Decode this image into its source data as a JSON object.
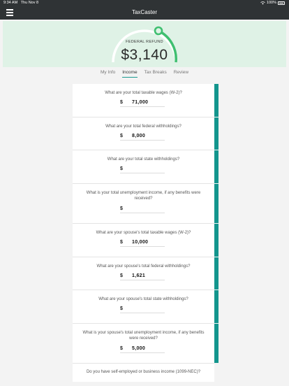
{
  "status_bar": {
    "time": "9:34 AM",
    "date": "Thu Nov 8",
    "battery": "100%"
  },
  "app": {
    "title": "TaxCaster"
  },
  "refund": {
    "label": "FEDERAL REFUND",
    "amount": "$3,140"
  },
  "tabs": [
    {
      "label": "My Info",
      "active": false
    },
    {
      "label": "Income",
      "active": true
    },
    {
      "label": "Tax Breaks",
      "active": false
    },
    {
      "label": "Review",
      "active": false
    }
  ],
  "colors": {
    "accent": "#13958d",
    "panel": "#dff2e6",
    "header": "#2f3335",
    "gauge": "#3fbf70"
  },
  "currency_symbol": "$",
  "questions": [
    {
      "question": "What are your total taxable wages (W-2)?",
      "value": "71,000"
    },
    {
      "question": "What are your total federal withholdings?",
      "value": "8,000"
    },
    {
      "question": "What are your total state withholdings?",
      "value": ""
    },
    {
      "question": "What is your total unemployment income, if any benefits were received?",
      "value": ""
    },
    {
      "question": "What are your spouse's total taxable wages (W-2)?",
      "value": "10,000"
    },
    {
      "question": "What are your spouse's total federal withholdings?",
      "value": "1,621"
    },
    {
      "question": "What are your spouse's total state withholdings?",
      "value": ""
    },
    {
      "question": "What is your spouse's total unemployment income, if any benefits were received?",
      "value": "5,000"
    }
  ],
  "last_question": "Do you have self-employed or business income (1099-NEC)?"
}
